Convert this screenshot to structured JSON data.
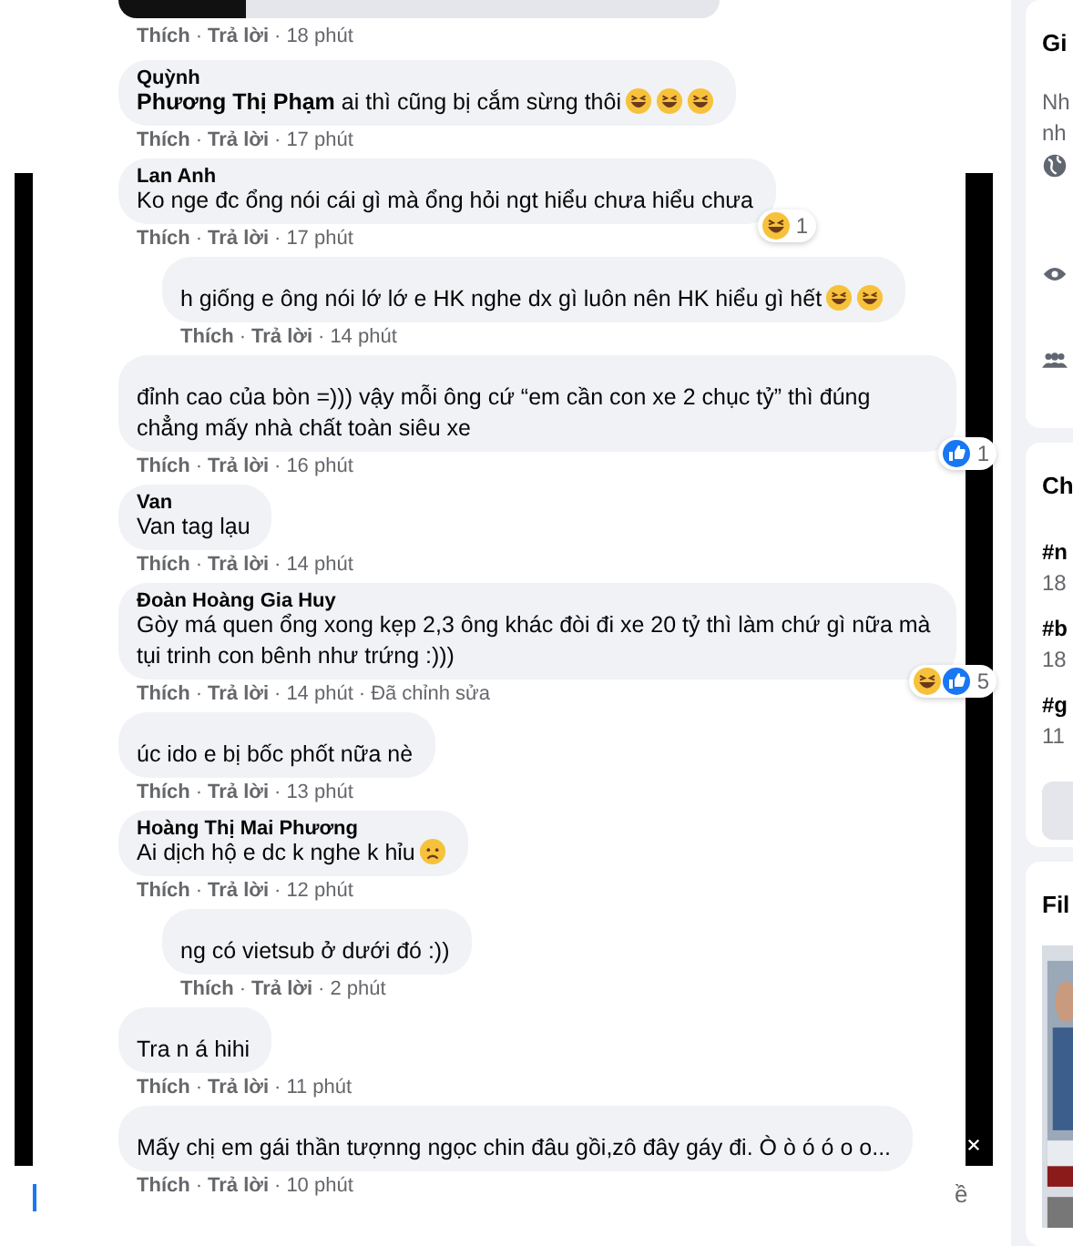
{
  "separator": "·",
  "top_actions": {
    "like": "Thích",
    "reply": "Trả lời",
    "time": "18 phút"
  },
  "comments": [
    {
      "reply": false,
      "name": "Quỳnh",
      "text": "**Phương Thị Phạm** ai thì cũng bị cắm sừng thôi",
      "emojis": [
        {
          "kind": "haha"
        },
        {
          "kind": "haha"
        },
        {
          "kind": "haha"
        }
      ],
      "actions": {
        "like": "Thích",
        "reply": "Trả lời",
        "time": "17 phút"
      }
    },
    {
      "reply": false,
      "name": "Lan Anh",
      "text": "Ko nge đc ổng nói cái gì mà ổng hỏi ngt hiểu chưa hiểu chưa",
      "reactions": {
        "icons": [
          {
            "kind": "haha"
          }
        ],
        "count": "1"
      },
      "actions": {
        "like": "Thích",
        "reply": "Trả lời",
        "time": "17 phút"
      }
    },
    {
      "reply": true,
      "text": "h giống e ông nói lớ lớ e HK nghe dx gì luôn nên HK hiểu gì hết",
      "emojis": [
        {
          "kind": "haha"
        },
        {
          "kind": "haha"
        }
      ],
      "actions": {
        "like": "Thích",
        "reply": "Trả lời",
        "time": "14 phút"
      }
    },
    {
      "reply": false,
      "text": "đỉnh cao của bòn =))) vậy mỗi ông cứ “em cần con xe 2 chục tỷ” thì đúng chẳng mấy nhà chất toàn siêu xe",
      "reactions": {
        "icons": [
          {
            "kind": "like"
          }
        ],
        "count": "1"
      },
      "actions": {
        "like": "Thích",
        "reply": "Trả lời",
        "time": "16 phút"
      }
    },
    {
      "reply": false,
      "name": "Van",
      "text": "Van tag lạu",
      "actions": {
        "like": "Thích",
        "reply": "Trả lời",
        "time": "14 phút"
      }
    },
    {
      "reply": false,
      "name": "Đoàn Hoàng Gia Huy",
      "text": "Gòy má quen ổng xong kẹp 2,3 ông khác đòi đi xe 20 tỷ thì làm chứ gì nữa mà tụi trinh con bênh như trứng :)))",
      "reactions": {
        "icons": [
          {
            "kind": "haha"
          },
          {
            "kind": "like"
          }
        ],
        "count": "5"
      },
      "actions": {
        "like": "Thích",
        "reply": "Trả lời",
        "time": "14 phút",
        "edited": "Đã chỉnh sửa"
      }
    },
    {
      "reply": false,
      "text": "úc ido e bị bốc phốt nữa nè",
      "actions": {
        "like": "Thích",
        "reply": "Trả lời",
        "time": "13 phút"
      }
    },
    {
      "reply": false,
      "name": "Hoàng Thị Mai Phương",
      "text": "Ai dịch hộ e dc k nghe k hỉu",
      "emojis": [
        {
          "kind": "sad"
        }
      ],
      "actions": {
        "like": "Thích",
        "reply": "Trả lời",
        "time": "12 phút"
      }
    },
    {
      "reply": true,
      "text": "ng có vietsub ở dưới đó :))",
      "actions": {
        "like": "Thích",
        "reply": "Trả lời",
        "time": "2 phút"
      }
    },
    {
      "reply": false,
      "text": "Tra n á hihi",
      "actions": {
        "like": "Thích",
        "reply": "Trả lời",
        "time": "11 phút"
      }
    },
    {
      "reply": false,
      "text": "Mấy chị em gái thần tượnng ngọc chin đâu gồi,zô đây gáy đi. Ò ò ó ó o o...",
      "actions": {
        "like": "Thích",
        "reply": "Trả lời",
        "time": "10 phút"
      }
    }
  ],
  "fragment_text": "ề",
  "sidebar": {
    "about": {
      "title": "Gi",
      "lines": [
        "Nh",
        "nh"
      ]
    },
    "trends": {
      "title": "Ch",
      "items": [
        {
          "tag": "#n",
          "count": "18"
        },
        {
          "tag": "#b",
          "count": "18"
        },
        {
          "tag": "#g",
          "count": "11"
        }
      ]
    },
    "films": {
      "title": "Fil"
    }
  }
}
